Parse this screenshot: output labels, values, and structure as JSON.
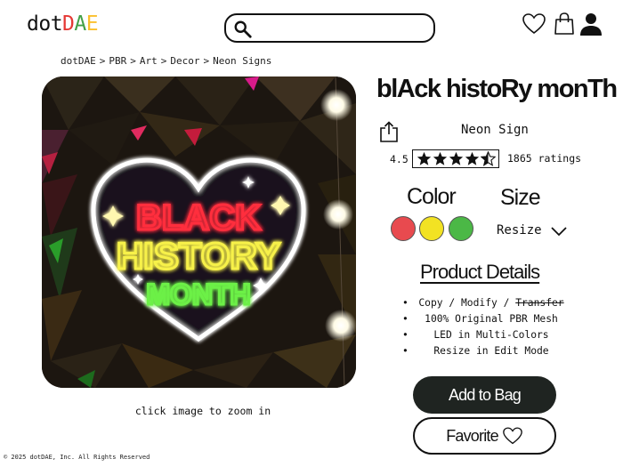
{
  "header": {
    "logo": {
      "part1": "dot",
      "part2": "D",
      "part3": "A",
      "part4": "E"
    },
    "search": {
      "placeholder": "",
      "value": ""
    },
    "icons": [
      "heart-icon",
      "shopping-bag-icon",
      "user-icon"
    ]
  },
  "breadcrumb": [
    "dotDAE",
    ">",
    "PBR",
    ">",
    "Art",
    ">",
    "Decor",
    ">",
    "Neon Signs"
  ],
  "product": {
    "title": "blAck histoRy monTh",
    "subtitle": "Neon Sign",
    "rating": "4.5",
    "ratings_count": "1865 ratings",
    "stars": 4.5,
    "color_label": "Color",
    "size_label": "Size",
    "colors": [
      "#e84a4f",
      "#f2e223",
      "#4bb846"
    ],
    "size_value": "Resize",
    "details_heading": "Product Details",
    "features": {
      "f1_a": "Copy / Modify / ",
      "f1_b": "Transfer",
      "f2": "100% Original PBR Mesh",
      "f3": "LED in Multi-Colors",
      "f4": "Resize in Edit Mode"
    },
    "add_to_bag": "Add to Bag",
    "favorite": "Favorite"
  },
  "image": {
    "zoom_hint": "click image to zoom in",
    "sign_line1": "BLACK",
    "sign_line2": "HISTORY",
    "sign_line3": "MONTH"
  },
  "footer": "© 2025 dotDAE, Inc. All Rights Reserved",
  "accent_colors": {
    "red": "#e53935",
    "green": "#43a047",
    "yellow": "#fbc02d",
    "button_dark": "#1f2421"
  }
}
